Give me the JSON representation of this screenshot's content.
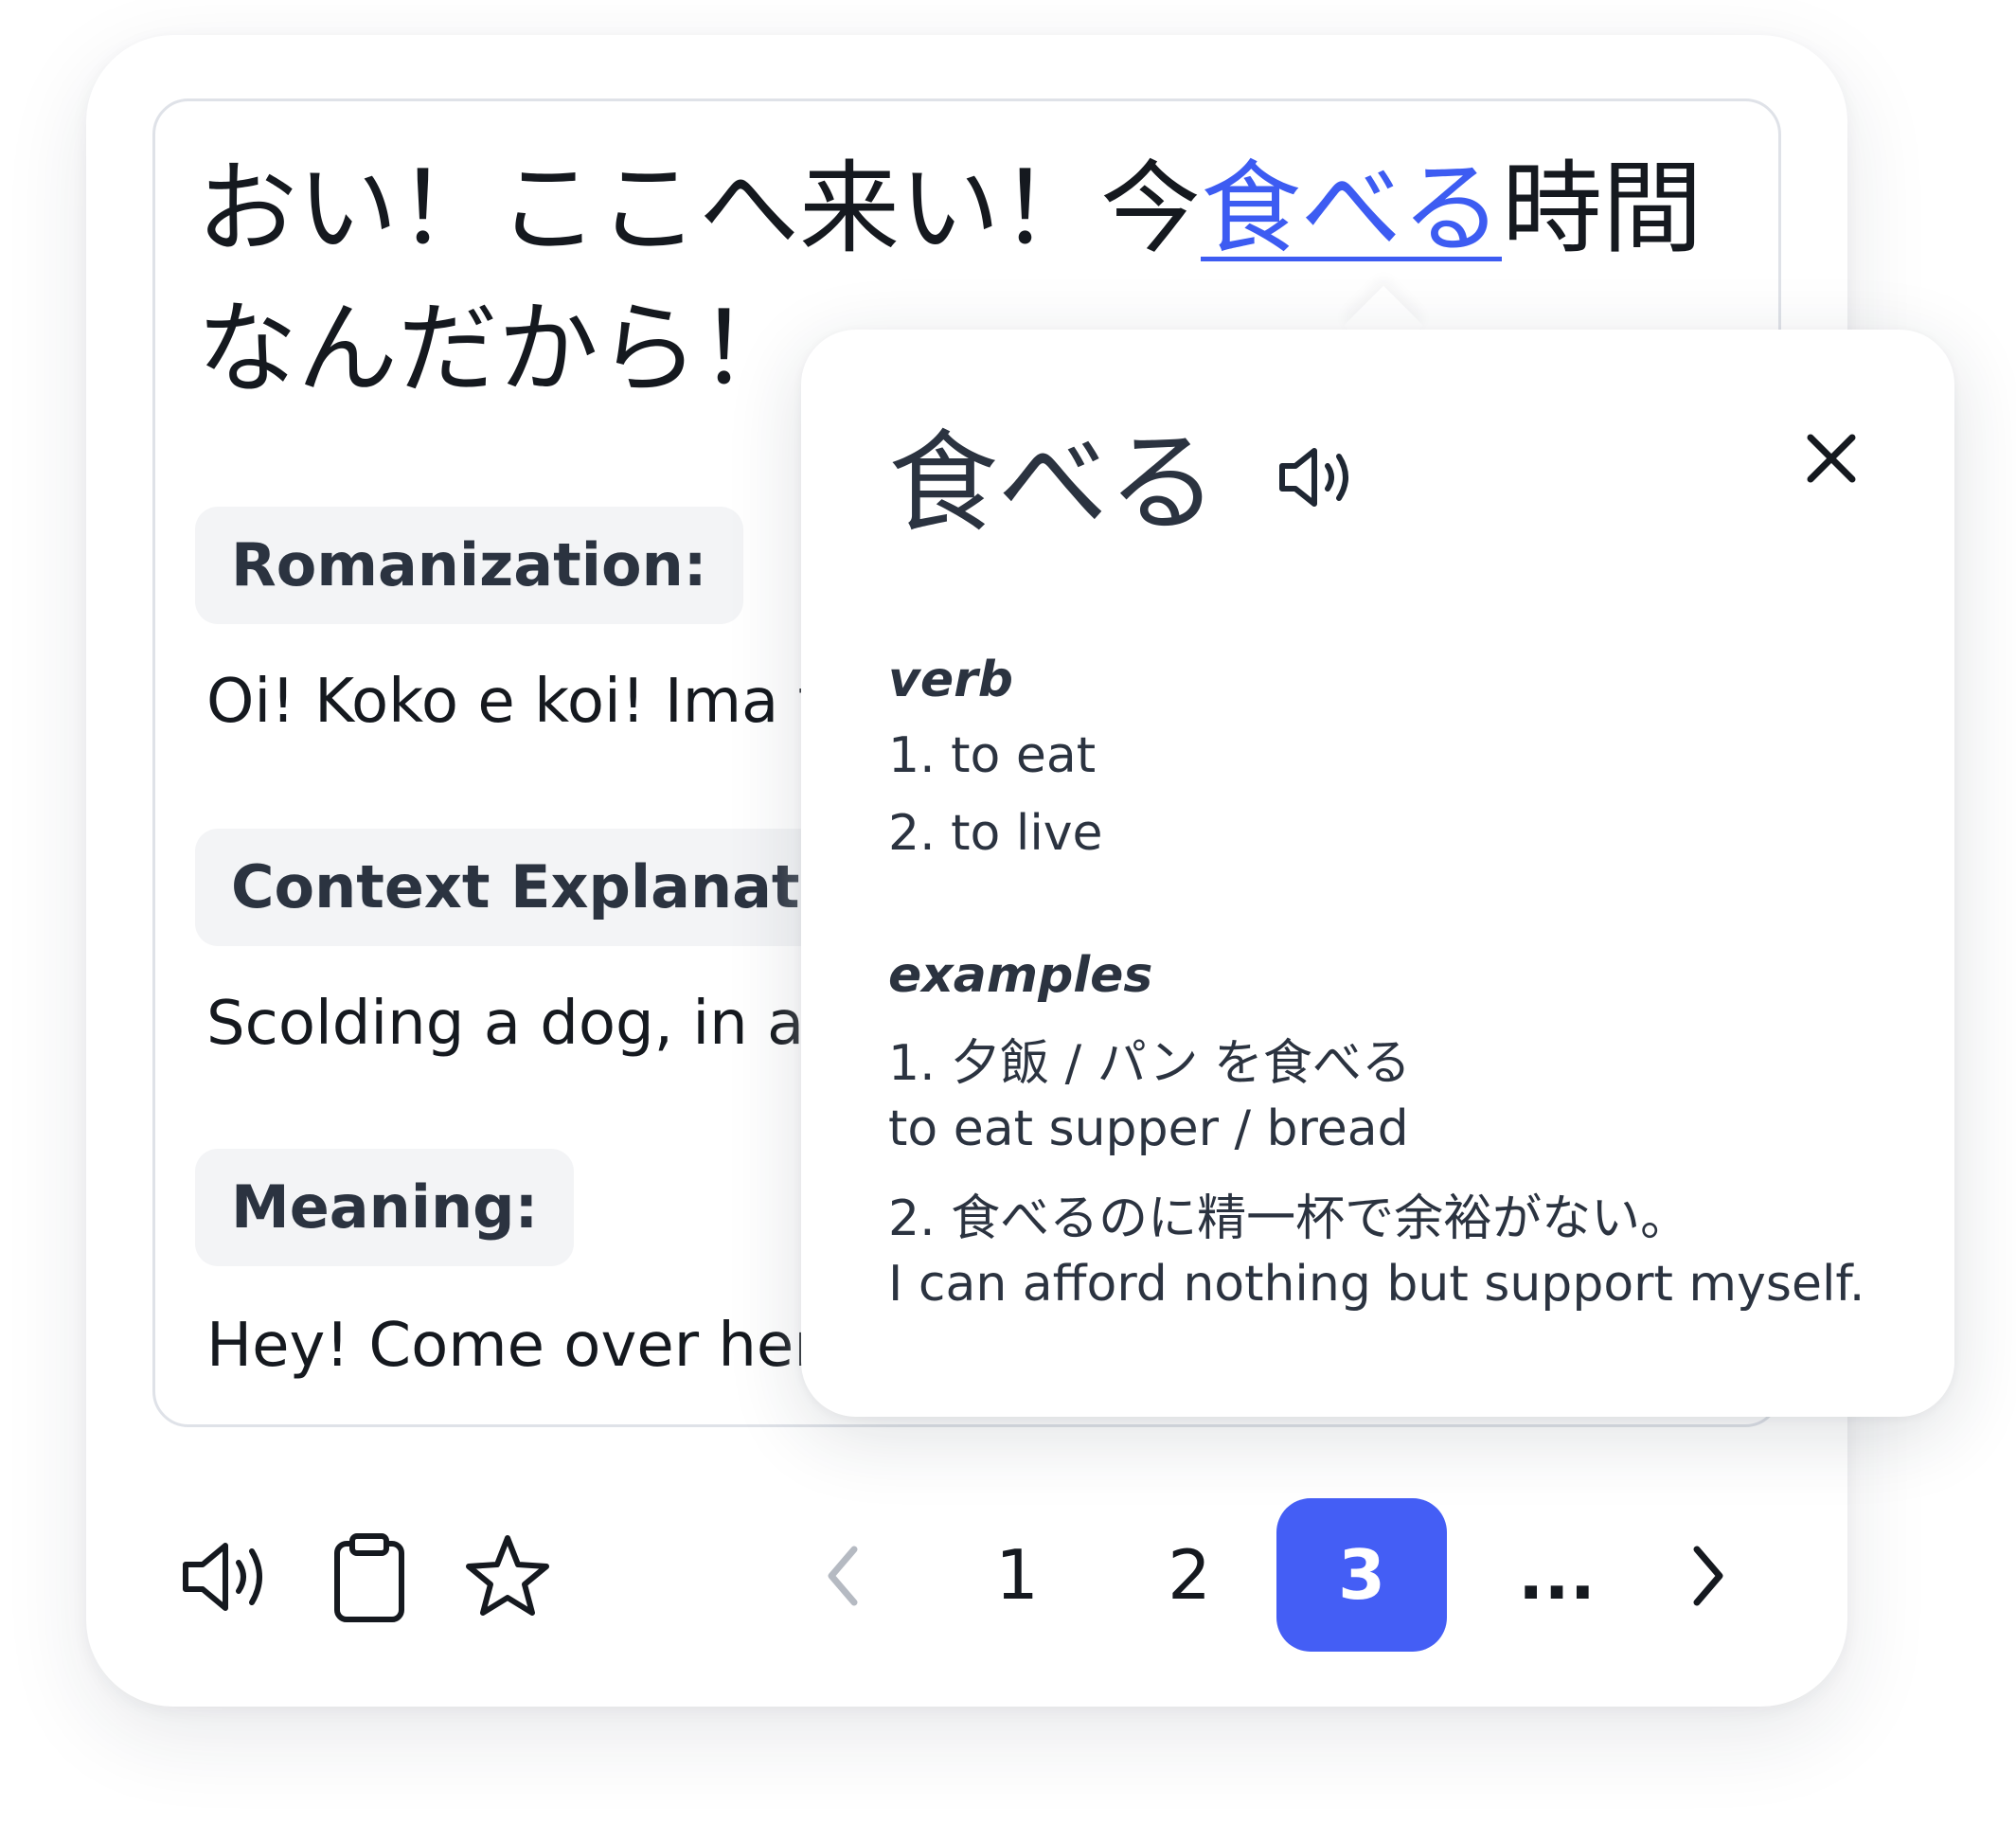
{
  "sentence": {
    "before": "おい！ここへ来い！今",
    "highlight": "食べる",
    "after": "時間なんだから！"
  },
  "sections": [
    {
      "label": "Romanization:",
      "text": "Oi! Koko e koi! Ima ta"
    },
    {
      "label": "Context Explanation",
      "text": "Scolding a dog, in a"
    },
    {
      "label": "Meaning:",
      "text": "Hey! Come over here"
    }
  ],
  "popup": {
    "word": "食べる",
    "pos_label": "verb",
    "definitions": [
      "1. to eat",
      "2. to live"
    ],
    "examples_label": "examples",
    "examples": [
      "1. 夕飯 / パン を食べる",
      "to eat supper / bread",
      "2. 食べるのに精一杯で余裕がない。",
      "I can afford nothing but support myself."
    ]
  },
  "pagination": {
    "pages": [
      "1",
      "2",
      "3"
    ],
    "current": "3",
    "ellipsis": "..."
  },
  "colors": {
    "accent": "#445ef5",
    "link": "#3d5cf2",
    "label_bg": "#f3f4f6",
    "text": "#15191f"
  },
  "icons": {
    "toolbar": [
      "speaker-icon",
      "clipboard-icon",
      "star-icon"
    ],
    "popup": [
      "speaker-icon",
      "close-icon"
    ],
    "pager": [
      "chevron-left-icon",
      "chevron-right-icon"
    ]
  }
}
